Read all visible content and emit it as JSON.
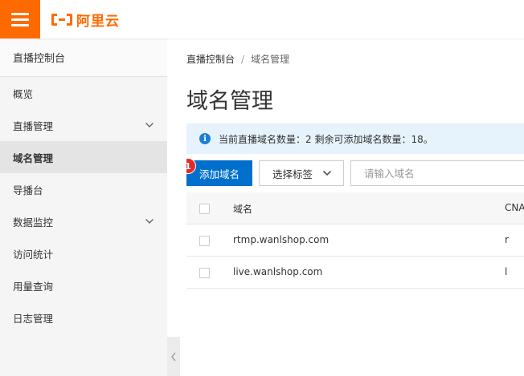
{
  "header": {
    "brand_text": "阿里云",
    "brand_color": "#ff6a00",
    "menu_icon": "hamburger-icon"
  },
  "sidebar": {
    "title": "直播控制台",
    "items": [
      {
        "label": "概览",
        "expandable": false,
        "active": false
      },
      {
        "label": "直播管理",
        "expandable": true,
        "active": false
      },
      {
        "label": "域名管理",
        "expandable": false,
        "active": true
      },
      {
        "label": "导播台",
        "expandable": false,
        "active": false
      },
      {
        "label": "数据监控",
        "expandable": true,
        "active": false
      },
      {
        "label": "访问统计",
        "expandable": false,
        "active": false
      },
      {
        "label": "用量查询",
        "expandable": false,
        "active": false
      },
      {
        "label": "日志管理",
        "expandable": false,
        "active": false
      }
    ]
  },
  "breadcrumb": {
    "root": "直播控制台",
    "separator": "/",
    "current": "域名管理"
  },
  "page": {
    "title": "域名管理"
  },
  "notice": {
    "icon": "info-icon",
    "text": "当前直播域名数量：2 剩余可添加域名数量：18。"
  },
  "toolbar": {
    "add_label": "添加域名",
    "badge": "1",
    "tag_select_label": "选择标签",
    "search_placeholder": "请输入域名",
    "primary_color": "#0070cc"
  },
  "table": {
    "headers": {
      "domain": "域名",
      "cname": "CNA"
    },
    "rows": [
      {
        "domain": "rtmp.wanlshop.com",
        "cname": "r"
      },
      {
        "domain": "live.wanlshop.com",
        "cname": "l"
      }
    ]
  }
}
